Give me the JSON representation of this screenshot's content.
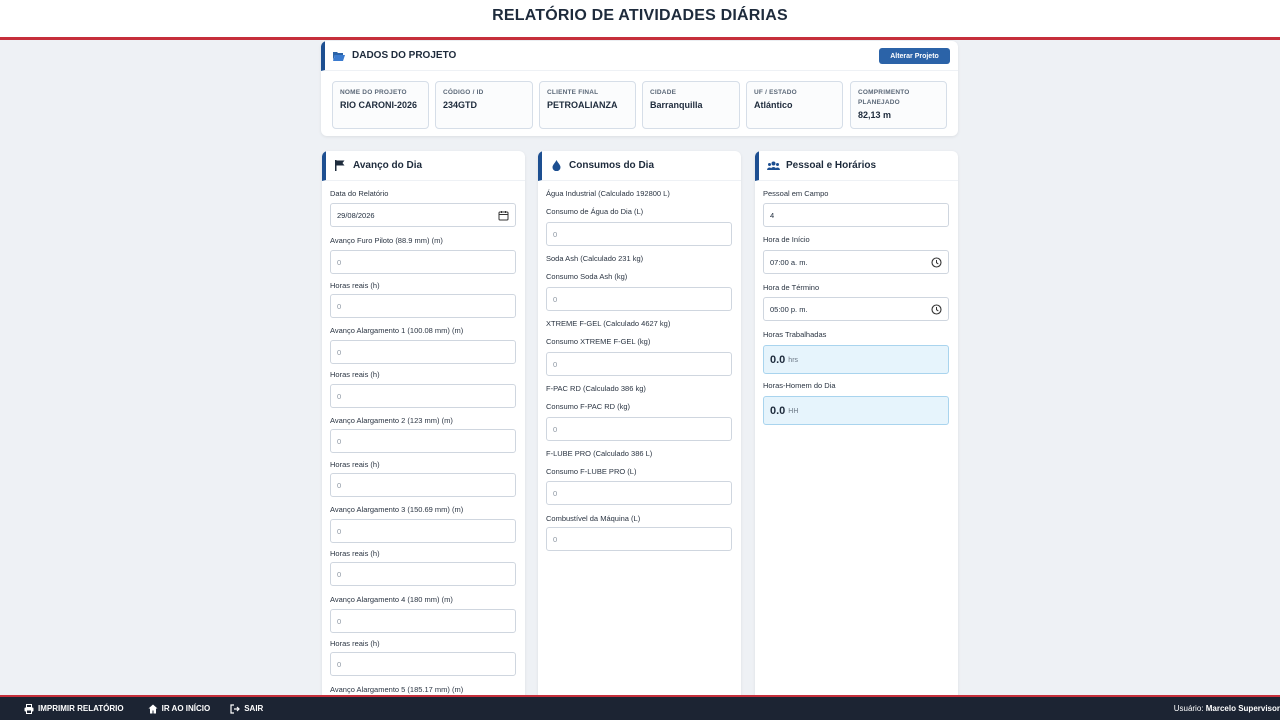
{
  "page_title": "RELATÓRIO DE ATIVIDADES DIÁRIAS",
  "project": {
    "header": "DADOS DO PROJETO",
    "change_button": "Alterar Projeto",
    "fields": [
      {
        "label": "NOME DO PROJETO",
        "value": "RIO CARONI-2026"
      },
      {
        "label": "CÓDIGO / ID",
        "value": "234GTD"
      },
      {
        "label": "CLIENTE FINAL",
        "value": "PETROALIANZA"
      },
      {
        "label": "CIDADE",
        "value": "Barranquilla"
      },
      {
        "label": "UF / ESTADO",
        "value": "Atlántico"
      },
      {
        "label": "COMPRIMENTO PLANEJADO",
        "value": "82,13 m"
      }
    ]
  },
  "progress": {
    "header": "Avanço do Dia",
    "date_label": "Data do Relatório",
    "date_value": "29/08/2026",
    "fields": [
      {
        "label": "Avanço Furo Piloto (88.9 mm) (m)",
        "placeholder": "0"
      },
      {
        "label": "Horas reais (h)",
        "placeholder": "0"
      },
      {
        "label": "Avanço Alargamento 1 (100.08 mm) (m)",
        "placeholder": "0"
      },
      {
        "label": "Horas reais (h)",
        "placeholder": "0"
      },
      {
        "label": "Avanço Alargamento 2 (123 mm) (m)",
        "placeholder": "0"
      },
      {
        "label": "Horas reais (h)",
        "placeholder": "0"
      },
      {
        "label": "Avanço Alargamento 3 (150.69 mm) (m)",
        "placeholder": "0"
      },
      {
        "label": "Horas reais (h)",
        "placeholder": "0"
      },
      {
        "label": "Avanço Alargamento 4 (180 mm) (m)",
        "placeholder": "0"
      },
      {
        "label": "Horas reais (h)",
        "placeholder": "0"
      }
    ],
    "trailing_label": "Avanço Alargamento 5 (185.17 mm) (m)"
  },
  "consumption": {
    "header": "Consumos do Dia",
    "groups": [
      {
        "calc": "Água Industrial (Calculado 192800 L)",
        "label": "Consumo de Água do Dia (L)",
        "placeholder": "0"
      },
      {
        "calc": "Soda Ash (Calculado 231 kg)",
        "label": "Consumo Soda Ash (kg)",
        "placeholder": "0"
      },
      {
        "calc": "XTREME F-GEL (Calculado 4627 kg)",
        "label": "Consumo XTREME F-GEL (kg)",
        "placeholder": "0"
      },
      {
        "calc": "F-PAC RD (Calculado 386 kg)",
        "label": "Consumo F-PAC RD (kg)",
        "placeholder": "0"
      },
      {
        "calc": "F-LUBE PRO (Calculado 386 L)",
        "label": "Consumo F-LUBE PRO (L)",
        "placeholder": "0"
      }
    ],
    "fuel_label": "Combustível da Máquina (L)",
    "fuel_placeholder": "0"
  },
  "staff": {
    "header": "Pessoal e Horários",
    "people_label": "Pessoal em Campo",
    "people_value": "4",
    "start_label": "Hora de Início",
    "start_value": "07:00 a. m.",
    "end_label": "Hora de Término",
    "end_value": "05:00 p. m.",
    "worked_label": "Horas Trabalhadas",
    "worked_value": "0.0",
    "worked_unit": "hrs",
    "manhours_label": "Horas-Homem do Dia",
    "manhours_value": "0.0",
    "manhours_unit": "HH"
  },
  "footer": {
    "print": "IMPRIMIR RELATÓRIO",
    "home": "IR AO INÍCIO",
    "exit": "SAIR",
    "user_prefix": "Usuário:",
    "user_name": "Marcelo Supervisor"
  },
  "colors": {
    "accent": "#1d4f91",
    "brand_red": "#c62f3b",
    "button": "#2b63a8",
    "footer_bg": "#1c2433"
  },
  "icons": [
    "folder-open-icon",
    "flag-icon",
    "droplet-icon",
    "users-icon",
    "calendar-icon",
    "clock-icon",
    "printer-icon",
    "home-icon",
    "logout-icon"
  ]
}
